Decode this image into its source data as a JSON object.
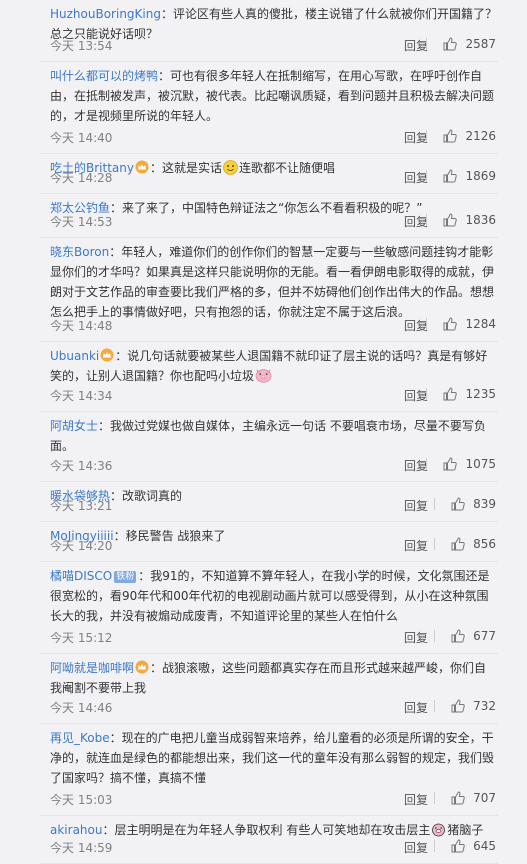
{
  "reply_label": "回复",
  "comments": [
    {
      "user": "HuzhouBoringKing",
      "badge": "",
      "tag": "",
      "text": "评论区有些人真的傻批，楼主说错了什么就被你们开国籍了？总之只能说好话呗？",
      "emoji_after": "",
      "time": "今天 13:54",
      "likes": "2587"
    },
    {
      "user": "叫什么都可以的烤鸭",
      "badge": "",
      "tag": "",
      "text": "可也有很多年轻人在抵制缩写，在用心写歌，在呼吁创作自由，在抵制被发声，被沉默，被代表。比起嘲讽质疑，看到问题并且积极去解决问题的，才是视频里所说的年轻人。",
      "emoji_after": "",
      "time": "今天 14:40",
      "likes": "2126"
    },
    {
      "user": "吃土的Brittany",
      "badge": "crown",
      "tag": "",
      "text": "这就是实话",
      "emoji_after": "smile",
      "text2": "连歌都不让随便唱",
      "time": "今天 14:28",
      "likes": "1869"
    },
    {
      "user": "郑太公钓鱼",
      "badge": "",
      "tag": "",
      "text": "来了来了，中国特色辩证法之“你怎么不看看积极的呢？”",
      "emoji_after": "",
      "time": "今天 14:53",
      "likes": "1836"
    },
    {
      "user": "晓东Boron",
      "badge": "",
      "tag": "",
      "text": "年轻人，难道你们的创作你们的智慧一定要与一些敏感问题挂钩才能彰显你们的才华吗？如果真是这样只能说明你的无能。看一看伊朗电影取得的成就，伊朗对于文艺作品的审查要比我们严格的多，但并不妨碍他们创作出伟大的作品。想想怎么把手上的事情做好吧，只有抱怨的话，你就注定不属于这后浪。",
      "emoji_after": "",
      "time": "今天 14:48",
      "likes": "1284"
    },
    {
      "user": "Ubuanki",
      "badge": "crown",
      "tag": "",
      "text": "说几句话就要被某些人退国籍不就印证了层主说的话吗？真是有够好笑的，让别人退国籍？你也配吗小垃圾",
      "emoji_after": "pig",
      "time": "今天 14:34",
      "likes": "1235"
    },
    {
      "user": "阿胡女士",
      "badge": "",
      "tag": "",
      "text": "我做过党媒也做自媒体，主编永远一句话 不要唱衰市场，尽量不要写负面。",
      "emoji_after": "",
      "time": "今天 14:36",
      "likes": "1075"
    },
    {
      "user": "暖水袋够热",
      "badge": "",
      "tag": "",
      "text": "改歌词真的",
      "emoji_after": "",
      "time": "今天 13:21",
      "likes": "839"
    },
    {
      "user": "MoJingyiiiii",
      "badge": "",
      "tag": "",
      "text": "移民警告 战狼来了",
      "emoji_after": "",
      "time": "今天 14:20",
      "likes": "856"
    },
    {
      "user": "橘喵DISCO",
      "badge": "",
      "tag": "铁粉",
      "text": "我91的，不知道算不算年轻人，在我小学的时候，文化氛围还是很宽松的，看90年代和00年代初的电视剧动画片就可以感受得到，从小在这种氛围长大的我，并没有被煽动成废青，不知道评论里的某些人在怕什么",
      "emoji_after": "",
      "time": "今天 15:12",
      "likes": "677"
    },
    {
      "user": "阿呦就是咖啡啊",
      "badge": "crown",
      "tag": "",
      "text": "战狼滚嗷，这些问题都真实存在而且形式越来越严峻，你们自我阉割不要带上我",
      "emoji_after": "",
      "time": "今天 14:46",
      "likes": "732"
    },
    {
      "user": "再见_Kobe",
      "badge": "",
      "tag": "",
      "text": "现在的广电把儿童当成弱智来培养，给儿童看的必须是所谓的安全，干净的，就连血是绿色的都能想出来，我们这一代的童年没有那么弱智的规定，我们毁了国家吗？搞不懂，真搞不懂",
      "emoji_after": "",
      "time": "今天 15:03",
      "likes": "707"
    },
    {
      "user": "akirahou",
      "badge": "",
      "tag": "",
      "text": "层主明明是在为年轻人争取权利 有些人可笑地却在攻击层主",
      "emoji_after": "pigface",
      "text2": "猪脑子",
      "time": "今天 14:59",
      "likes": "645"
    }
  ],
  "colors": {
    "link": "#3b79c9",
    "time": "#808080",
    "bg": "#f2f2f5"
  },
  "icons": {
    "like": "thumbs-up-icon",
    "crown": "crown-badge-icon",
    "smile": "smile-emoji-icon",
    "pig": "pig-emoji-icon"
  }
}
